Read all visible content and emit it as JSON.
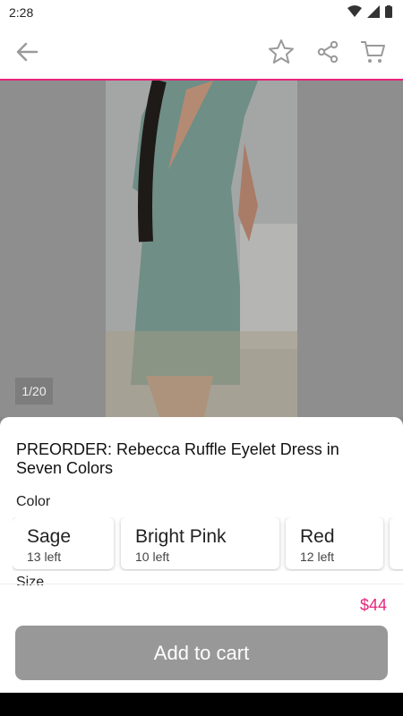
{
  "status": {
    "time": "2:28"
  },
  "gallery": {
    "counter": "1/20"
  },
  "product": {
    "title": "PREORDER: Rebecca Ruffle Eyelet Dress in Seven Colors",
    "color_label": "Color",
    "size_label": "Size",
    "colors": [
      {
        "name": "Sage",
        "stock": "13 left"
      },
      {
        "name": "Bright Pink",
        "stock": "10 left"
      },
      {
        "name": "Red",
        "stock": "12 left"
      }
    ],
    "price": "$44",
    "add_to_cart_label": "Add to cart"
  },
  "colors": {
    "accent": "#e8247c",
    "button_disabled": "#989898"
  }
}
